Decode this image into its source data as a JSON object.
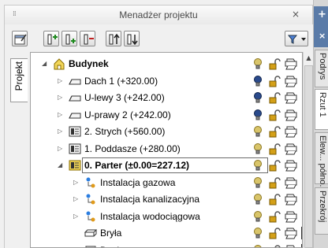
{
  "panel": {
    "title": "Menadżer projektu",
    "grip_icon": "grip-icon",
    "close_glyph": "×"
  },
  "toolbar": {
    "buttons": [
      {
        "name": "properties-button",
        "icon": "properties-icon"
      },
      {
        "name": "add-level-above-button",
        "icon": "add-level-icon"
      },
      {
        "name": "add-level-below-button",
        "icon": "add-level-below-icon"
      },
      {
        "name": "delete-level-button",
        "icon": "delete-level-icon"
      },
      {
        "name": "move-level-up-button",
        "icon": "move-up-icon"
      },
      {
        "name": "move-level-down-button",
        "icon": "move-down-icon"
      },
      {
        "name": "filter-dropdown-button",
        "icon": "filter-icon"
      }
    ]
  },
  "left_tab": {
    "label": "Projekt"
  },
  "tree": [
    {
      "label": "Budynek",
      "bold": true,
      "arrow": "◢",
      "icon": "building-icon",
      "bulb": "on",
      "lock": "open",
      "printer": true,
      "color": "multi"
    },
    {
      "label": "Dach 1 (+320.00)",
      "arrow": "▷",
      "icon": "roof-icon",
      "bulb": "off",
      "lock": "open",
      "printer": true,
      "color": "multi"
    },
    {
      "label": "U-lewy 3 (+242.00)",
      "arrow": "▷",
      "icon": "roof-icon",
      "bulb": "off",
      "lock": "open",
      "printer": true,
      "color": "multi"
    },
    {
      "label": "U-prawy 2 (+242.00)",
      "arrow": "▷",
      "icon": "roof-icon",
      "bulb": "off",
      "lock": "open",
      "printer": true,
      "color": "multi"
    },
    {
      "label": "2. Strych (+560.00)",
      "arrow": "▷",
      "icon": "level-icon",
      "bulb": "on",
      "lock": "open",
      "printer": true,
      "color": "multi"
    },
    {
      "label": "1. Poddasze (+280.00)",
      "arrow": "▷",
      "icon": "level-icon",
      "bulb": "on",
      "lock": "open",
      "printer": true,
      "color": "multi"
    },
    {
      "label": "0. Parter (±0.00=227.12)",
      "bold": true,
      "selected": true,
      "arrow": "◢",
      "icon": "active-level-icon",
      "bulb": "on",
      "lock": "open",
      "printer": true,
      "color": "multi"
    },
    {
      "label": "Instalacja gazowa",
      "arrow": "▷",
      "icon": "installation-icon",
      "bulb": "on",
      "lock": "open",
      "printer": true,
      "color": "multi"
    },
    {
      "label": "Instalacja kanalizacyjna",
      "arrow": "▷",
      "icon": "installation-icon",
      "bulb": "on",
      "lock": "open",
      "printer": true,
      "color": "multi"
    },
    {
      "label": "Instalacja wodociągowa",
      "arrow": "▷",
      "icon": "installation-icon",
      "bulb": "on",
      "lock": "open",
      "printer": true,
      "color": "multi"
    },
    {
      "label": "Bryła",
      "arrow": "",
      "icon": "solid-icon",
      "bulb": "on",
      "lock": "open",
      "printer": true,
      "color": "white"
    },
    {
      "label": "Dach",
      "arrow": "",
      "icon": "roof-part-icon",
      "bulb": "on",
      "lock": "open",
      "printer": true,
      "color": "red"
    }
  ],
  "right_dock": {
    "plus": "+",
    "close": "×",
    "tabs": [
      {
        "label": "Podrys",
        "active": false
      },
      {
        "label": "Rzut 1",
        "active": true
      },
      {
        "label": "Elew... półno...",
        "active": false
      },
      {
        "label": "Przekrój",
        "active": false
      }
    ]
  },
  "colors": {
    "bulb_on": "#d9c56a",
    "bulb_off": "#2a4a8c",
    "lock": "#d4a017",
    "swatch_red": "#b5321f",
    "highlight": "#c9e1f7"
  }
}
